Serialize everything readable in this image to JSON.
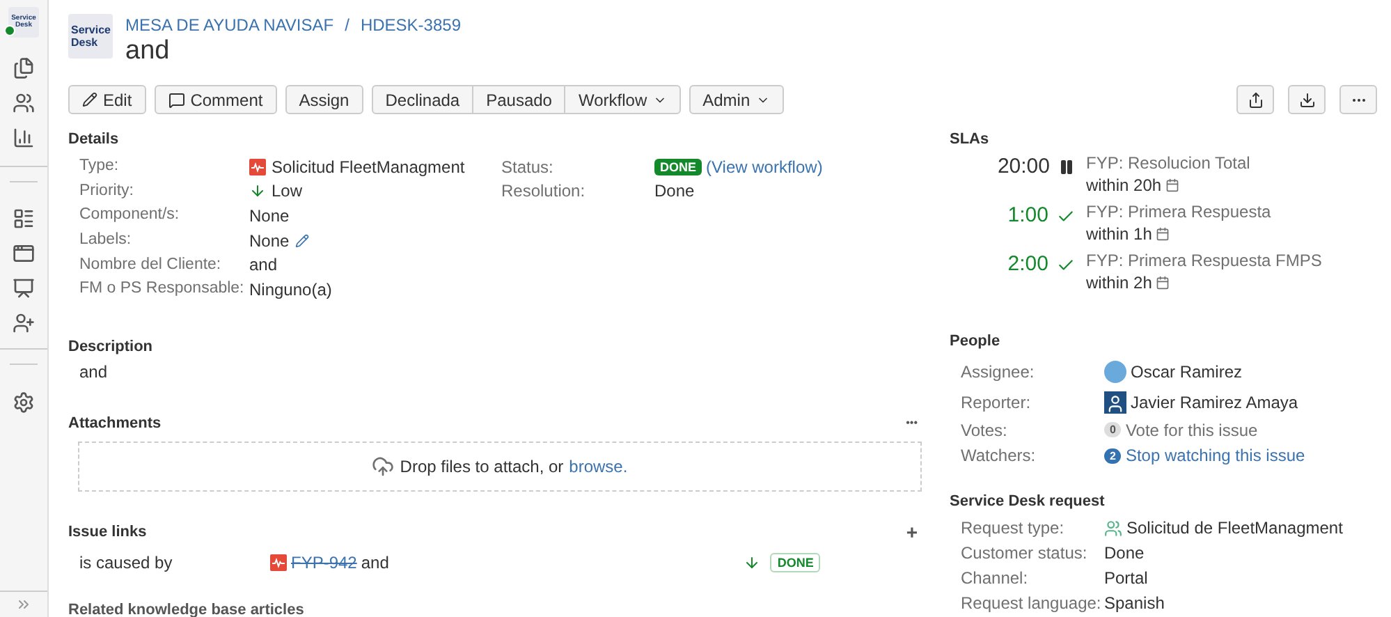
{
  "sidebar": {
    "logo": {
      "line_1": "Service",
      "line_2": "Desk"
    }
  },
  "header": {
    "logo": {
      "line_1": "Service",
      "line_2": "Desk"
    },
    "project": "MESA DE AYUDA NAVISAF",
    "separator": "/",
    "issue_key": "HDESK-3859",
    "title": "and"
  },
  "toolbar": {
    "groups": [
      [
        "Edit"
      ],
      [
        "Comment"
      ],
      [
        "Assign"
      ],
      [
        "Declinada",
        "Pausado",
        "Workflow"
      ],
      [
        "Admin"
      ]
    ]
  },
  "details": {
    "heading": "Details",
    "fields": [
      {
        "label": "Type:",
        "value": "Solicitud FleetManagment",
        "kind": "type"
      },
      {
        "label": "Priority:",
        "value": "Low",
        "kind": "priority"
      },
      {
        "label": "Component/s:",
        "value": "None",
        "kind": "text"
      },
      {
        "label": "Labels:",
        "value": "None",
        "kind": "editable"
      },
      {
        "label": "Nombre del Cliente:",
        "value": "and",
        "kind": "text"
      },
      {
        "label": "FM o PS Responsable:",
        "value": "Ninguno(a)",
        "kind": "text"
      }
    ],
    "status_label": "Status:",
    "status": "DONE",
    "view_workflow": "(View workflow)",
    "resolution_label": "Resolution:",
    "resolution": "Done"
  },
  "description": {
    "heading": "Description",
    "text": "and"
  },
  "attachments": {
    "heading": "Attachments",
    "more": "•••",
    "drop_text": "Drop files to attach, or",
    "browse": "browse."
  },
  "issue_links": {
    "heading": "Issue links",
    "add": "+",
    "links": [
      {
        "relation": "is caused by",
        "key": "FYP-942",
        "summary": "and",
        "resolved": true,
        "status": "DONE"
      }
    ]
  },
  "related": {
    "heading": "Related knowledge base articles"
  },
  "slas": {
    "heading": "SLAs",
    "items": [
      {
        "time": "20:00",
        "kind": "paused",
        "name": "FYP: Resolucion Total",
        "target": "within 20h"
      },
      {
        "time": "1:00",
        "kind": "met",
        "name": "FYP: Primera Respuesta",
        "target": "within 1h"
      },
      {
        "time": "2:00",
        "kind": "met",
        "name": "FYP: Primera Respuesta FMPS",
        "target": "within 2h"
      }
    ]
  },
  "people": {
    "heading": "People",
    "assignee_label": "Assignee:",
    "assignee": "Oscar Ramirez",
    "reporter_label": "Reporter:",
    "reporter": "Javier Ramirez Amaya",
    "votes_label": "Votes:",
    "votes_count": "0",
    "votes_link": "Vote for this issue",
    "watchers_label": "Watchers:",
    "watchers_count": "2",
    "watchers_link": "Stop watching this issue"
  },
  "service_desk_request": {
    "heading": "Service Desk request",
    "fields": [
      {
        "label": "Request type:",
        "value": "Solicitud de FleetManagment",
        "kind": "request-type"
      },
      {
        "label": "Customer status:",
        "value": "Done",
        "kind": "text"
      },
      {
        "label": "Channel:",
        "value": "Portal",
        "kind": "text"
      },
      {
        "label": "Request language:",
        "value": "Spanish",
        "kind": "text"
      }
    ]
  }
}
